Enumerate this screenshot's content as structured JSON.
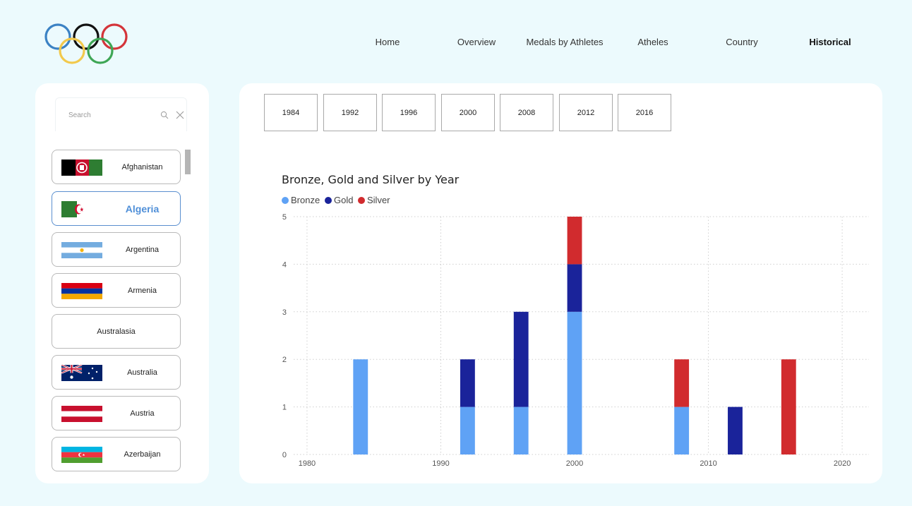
{
  "nav": {
    "items": [
      {
        "label": "Home",
        "active": false
      },
      {
        "label": "Overview",
        "active": false
      },
      {
        "label": "Medals by Athletes",
        "active": false
      },
      {
        "label": "Atheles",
        "active": false
      },
      {
        "label": "Country",
        "active": false
      },
      {
        "label": "Historical",
        "active": true
      }
    ]
  },
  "sidebar": {
    "search": {
      "placeholder": "Search"
    },
    "countries": [
      {
        "name": "Afghanistan",
        "flag": "afghanistan",
        "selected": false
      },
      {
        "name": "Algeria",
        "flag": "algeria",
        "selected": true
      },
      {
        "name": "Argentina",
        "flag": "argentina",
        "selected": false
      },
      {
        "name": "Armenia",
        "flag": "armenia",
        "selected": false
      },
      {
        "name": "Australasia",
        "flag": "",
        "selected": false
      },
      {
        "name": "Australia",
        "flag": "australia",
        "selected": false
      },
      {
        "name": "Austria",
        "flag": "austria",
        "selected": false
      },
      {
        "name": "Azerbaijan",
        "flag": "azerbaijan",
        "selected": false
      }
    ]
  },
  "year_slicer": {
    "years": [
      "1984",
      "1992",
      "1996",
      "2000",
      "2008",
      "2012",
      "2016"
    ]
  },
  "colors": {
    "bronze": "#5fa2f5",
    "gold": "#1a239a",
    "silver": "#d12b2e",
    "selected_text": "#4f8fd8"
  },
  "chart_data": {
    "type": "bar",
    "stacked": true,
    "title": "Bronze, Gold and Silver by Year",
    "xlabel": "",
    "ylabel": "",
    "x": [
      1984,
      1992,
      1996,
      2000,
      2008,
      2012,
      2016
    ],
    "series": [
      {
        "name": "Bronze",
        "color": "#5fa2f5",
        "values": [
          2,
          1,
          1,
          3,
          1,
          0,
          0
        ]
      },
      {
        "name": "Gold",
        "color": "#1a239a",
        "values": [
          0,
          1,
          2,
          1,
          0,
          1,
          0
        ]
      },
      {
        "name": "Silver",
        "color": "#d12b2e",
        "values": [
          0,
          0,
          0,
          1,
          1,
          0,
          2
        ]
      }
    ],
    "xlim": [
      1979,
      2022
    ],
    "xticks": [
      1980,
      1990,
      2000,
      2010,
      2020
    ],
    "ylim": [
      0,
      5
    ],
    "yticks": [
      0,
      1,
      2,
      3,
      4,
      5
    ],
    "grid": true,
    "legend": "top-left"
  }
}
